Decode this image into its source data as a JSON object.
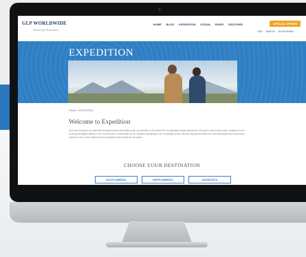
{
  "site": {
    "logo": "GLP WORLDWIDE",
    "tagline": "Travel for Travellers"
  },
  "nav": {
    "items": [
      "HOME",
      "BLOG",
      "EXPEDITION",
      "OCEAN",
      "RIVER",
      "DISCOVER"
    ],
    "special_offers": "SPECIAL OFFERS"
  },
  "utility": {
    "items": [
      "USD",
      "SIGN IN",
      "MY BOOKING"
    ]
  },
  "hero": {
    "title": "EXPEDITION"
  },
  "breadcrumb": "HOME  >  EXPEDITION",
  "welcome": {
    "title": "Welcome to Expedition",
    "body": "If you are looking for an adventure that goes beyond the beaten path, an expedition is the perfect fit. A completely unique experience of Europe's most remote areas, ranging from the far-flung Norwegian islands in the South Pacific, to small islets on the Svalbard archipelago in the Norwegian Arctic. Discover yourself and learn the vast landscapes and experiences aboard in some of the furthest and most pristine environments on the planet."
  },
  "choose": {
    "title": "CHOOSE YOUR DESTINATION",
    "destinations": [
      "SOUTH AMERICA",
      "NORTH AMERICA",
      "ANTARCTICA"
    ]
  },
  "colors": {
    "hero_blue": "#2d7ec3",
    "accent_orange": "#f0a52a",
    "navy": "#1f3d66"
  }
}
